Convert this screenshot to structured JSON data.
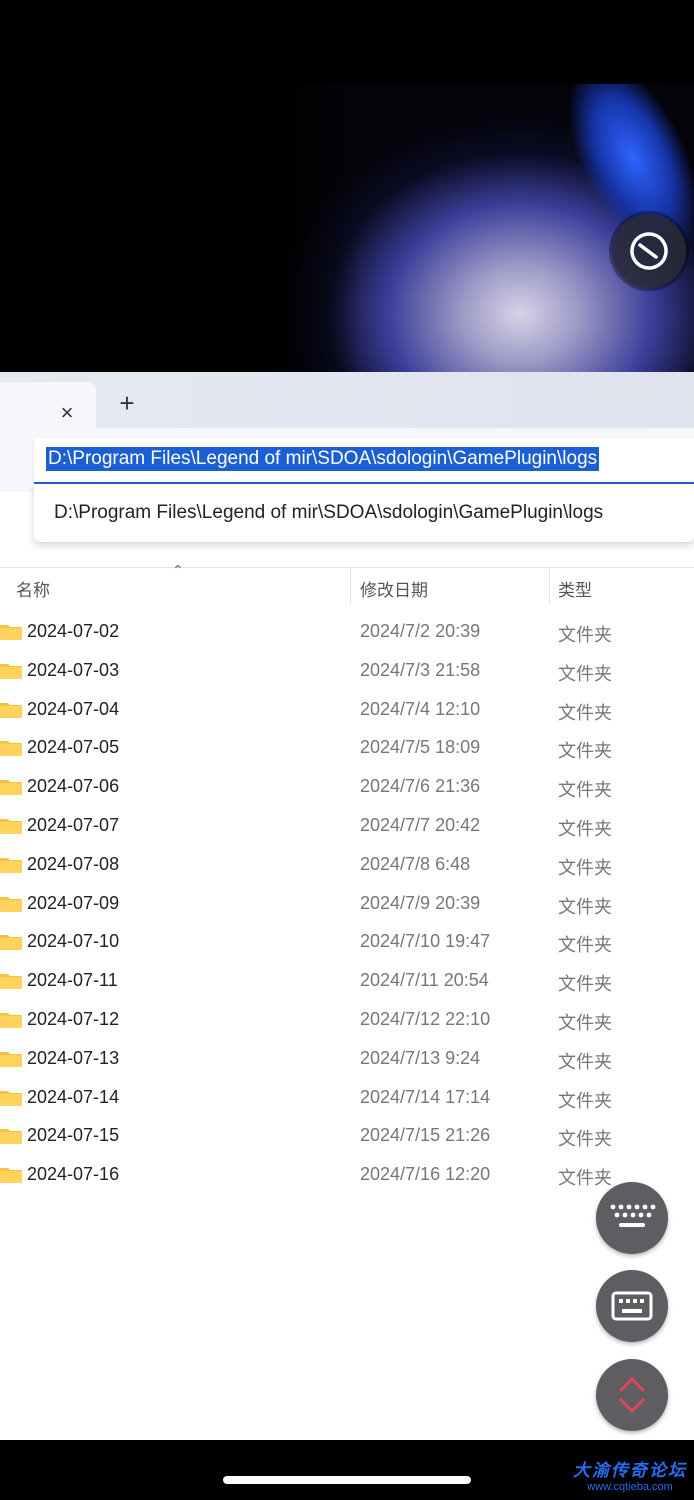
{
  "tab": {
    "close_label": "×",
    "add_label": "+"
  },
  "address_bar": {
    "path": "D:\\Program Files\\Legend of mir\\SDOA\\sdologin\\GamePlugin\\logs"
  },
  "suggestion": {
    "path": "D:\\Program Files\\Legend of mir\\SDOA\\sdologin\\GamePlugin\\logs"
  },
  "columns": {
    "name": "名称",
    "date": "修改日期",
    "type": "类型"
  },
  "files": [
    {
      "name": "2024-07-02",
      "date": "2024/7/2 20:39",
      "type": "文件夹"
    },
    {
      "name": "2024-07-03",
      "date": "2024/7/3 21:58",
      "type": "文件夹"
    },
    {
      "name": "2024-07-04",
      "date": "2024/7/4 12:10",
      "type": "文件夹"
    },
    {
      "name": "2024-07-05",
      "date": "2024/7/5 18:09",
      "type": "文件夹"
    },
    {
      "name": "2024-07-06",
      "date": "2024/7/6 21:36",
      "type": "文件夹"
    },
    {
      "name": "2024-07-07",
      "date": "2024/7/7 20:42",
      "type": "文件夹"
    },
    {
      "name": "2024-07-08",
      "date": "2024/7/8 6:48",
      "type": "文件夹"
    },
    {
      "name": "2024-07-09",
      "date": "2024/7/9 20:39",
      "type": "文件夹"
    },
    {
      "name": "2024-07-10",
      "date": "2024/7/10 19:47",
      "type": "文件夹"
    },
    {
      "name": "2024-07-11",
      "date": "2024/7/11 20:54",
      "type": "文件夹"
    },
    {
      "name": "2024-07-12",
      "date": "2024/7/12 22:10",
      "type": "文件夹"
    },
    {
      "name": "2024-07-13",
      "date": "2024/7/13 9:24",
      "type": "文件夹"
    },
    {
      "name": "2024-07-14",
      "date": "2024/7/14 17:14",
      "type": "文件夹"
    },
    {
      "name": "2024-07-15",
      "date": "2024/7/15 21:26",
      "type": "文件夹"
    },
    {
      "name": "2024-07-16",
      "date": "2024/7/16 12:20",
      "type": "文件夹"
    }
  ],
  "watermark": {
    "title": "大渝传奇论坛",
    "url": "www.cqtieba.com"
  },
  "icons": {
    "clock": "clock-icon",
    "folder": "folder-icon",
    "keyboard_dots": "keyboard-icon",
    "keyboard": "keyboard-icon",
    "expand": "chevron-updown-icon"
  },
  "colors": {
    "selection": "#1a5fd4",
    "folder": "#f5c343",
    "fab_bg": "#5d5d62",
    "expand_chevron": "#e0455a"
  }
}
